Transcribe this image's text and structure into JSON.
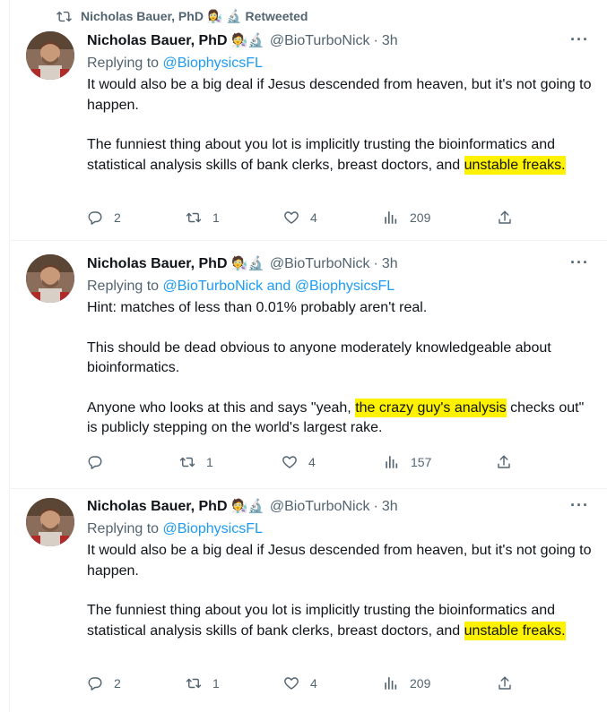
{
  "retweet_banner": {
    "text": "Nicholas Bauer, PhD 👩‍🔬 🔬 Retweeted"
  },
  "tweets": [
    {
      "author": {
        "name": "Nicholas Bauer, PhD",
        "emoji": "🧑‍🔬🔬",
        "handle": "@BioTurboNick",
        "time": "3h"
      },
      "replying_label": "Replying to",
      "replying_to": "@BiophysicsFL",
      "paragraphs": [
        {
          "text": "It would also be a big deal if Jesus descended from heaven, but it's not going to happen."
        },
        {
          "pre": "The funniest thing about you lot is implicitly trusting the bioinformatics and statistical analysis skills of bank clerks, breast doctors, and ",
          "highlight": "unstable freaks.",
          "post": ""
        }
      ],
      "stats": {
        "replies": "2",
        "retweets": "1",
        "likes": "4",
        "views": "209"
      }
    },
    {
      "author": {
        "name": "Nicholas Bauer, PhD",
        "emoji": "🧑‍🔬🔬",
        "handle": "@BioTurboNick",
        "time": "3h"
      },
      "replying_label": "Replying to",
      "replying_to": "@BioTurboNick and @BiophysicsFL",
      "paragraphs": [
        {
          "text": "Hint: matches of less than 0.01% probably aren't real."
        },
        {
          "text": "This should be dead obvious to anyone moderately knowledgeable about bioinformatics."
        },
        {
          "pre": "Anyone who looks at this and says \"yeah, ",
          "highlight": "the crazy guy's analysis",
          "post": " checks out\" is publicly stepping on the world's largest rake."
        }
      ],
      "stats": {
        "replies": "",
        "retweets": "1",
        "likes": "4",
        "views": "157"
      }
    },
    {
      "author": {
        "name": "Nicholas Bauer, PhD",
        "emoji": "🧑‍🔬🔬",
        "handle": "@BioTurboNick",
        "time": "3h"
      },
      "replying_label": "Replying to",
      "replying_to": "@BiophysicsFL",
      "paragraphs": [
        {
          "text": "It would also be a big deal if Jesus descended from heaven, but it's not going to happen."
        },
        {
          "pre": "The funniest thing about you lot is implicitly trusting the bioinformatics and statistical analysis skills of bank clerks, breast doctors, and ",
          "highlight": "unstable freaks.",
          "post": ""
        }
      ],
      "stats": {
        "replies": "2",
        "retweets": "1",
        "likes": "4",
        "views": "209"
      }
    }
  ],
  "icons": {
    "retweet_banner": "retweet-icon",
    "reply": "reply-icon",
    "retweet": "retweet-icon",
    "like": "heart-icon",
    "views": "views-icon",
    "share": "share-icon",
    "more": "more-icon"
  },
  "colors": {
    "highlight": "#fff200",
    "link": "#1d9bf0",
    "muted": "#536471",
    "text": "#0f1419"
  }
}
